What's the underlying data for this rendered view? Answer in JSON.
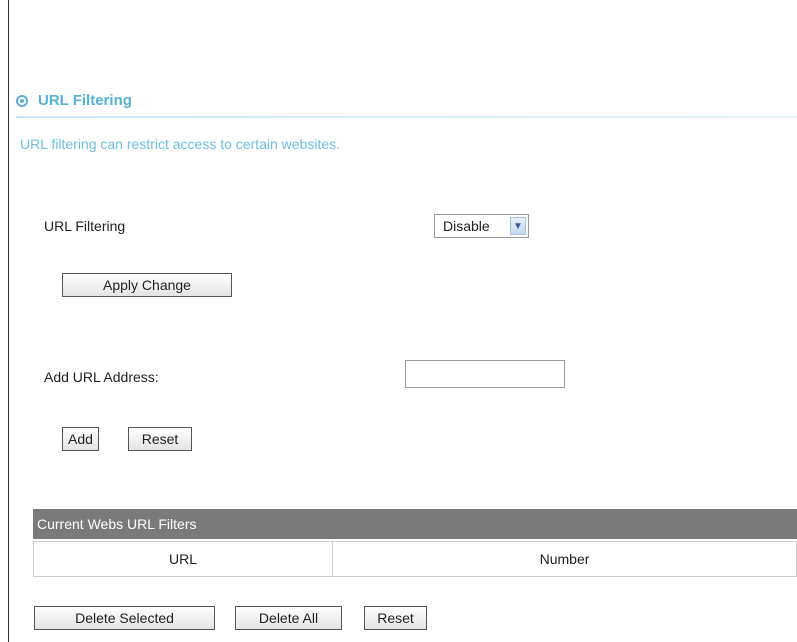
{
  "section": {
    "title": "URL Filtering",
    "description": "URL filtering can restrict access to certain websites."
  },
  "filtering": {
    "label": "URL Filtering",
    "selected": "Disable",
    "apply_label": "Apply Change"
  },
  "add_url": {
    "label": "Add URL Address:",
    "value": "",
    "add_label": "Add",
    "reset_label": "Reset"
  },
  "filters_table": {
    "title": "Current Webs URL Filters",
    "columns": [
      "URL",
      "Number"
    ],
    "rows": []
  },
  "actions": {
    "delete_selected_label": "Delete Selected",
    "delete_all_label": "Delete All",
    "reset_label": "Reset"
  },
  "colors": {
    "accent": "#55b2d8",
    "table_header_bg": "#7a7a7a"
  },
  "icons": {
    "section_icon": "radio-circle-icon",
    "select_arrow": "chevron-down-icon"
  }
}
